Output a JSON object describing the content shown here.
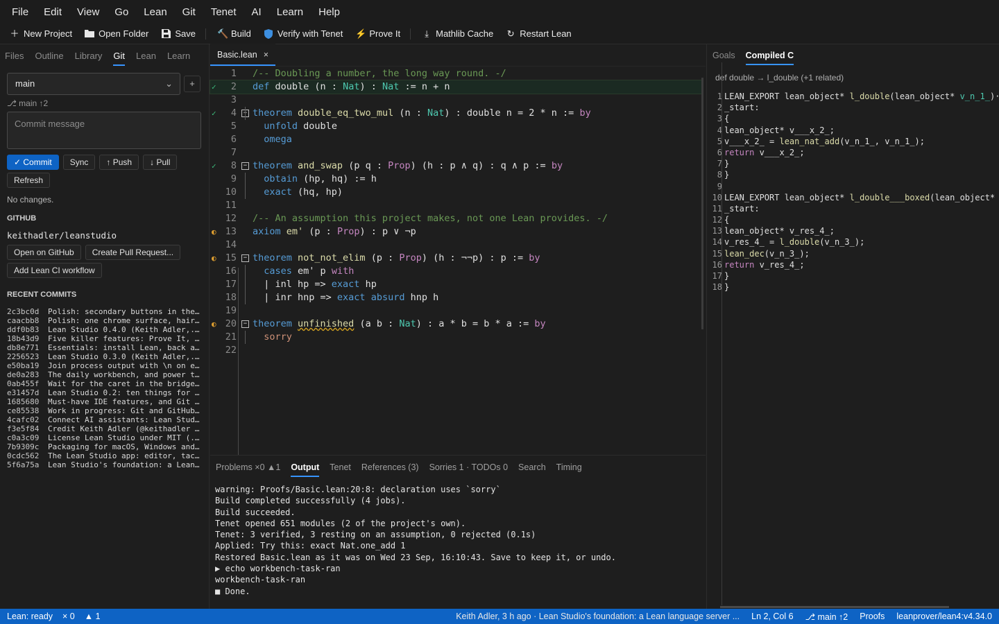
{
  "menu": [
    "File",
    "Edit",
    "View",
    "Go",
    "Lean",
    "Git",
    "Tenet",
    "AI",
    "Learn",
    "Help"
  ],
  "toolbar": {
    "new_project": "New Project",
    "open_folder": "Open Folder",
    "save": "Save",
    "build": "Build",
    "verify": "Verify with Tenet",
    "prove": "Prove It",
    "mathlib": "Mathlib Cache",
    "restart": "Restart Lean"
  },
  "left_tabs": [
    "Files",
    "Outline",
    "Library",
    "Git",
    "Lean",
    "Learn"
  ],
  "git": {
    "branch": "main",
    "plus": "+",
    "branch_info": "⎇ main ↑2",
    "commit_placeholder": "Commit message",
    "commit": "✓ Commit",
    "sync": "Sync",
    "push": "↑ Push",
    "pull": "↓ Pull",
    "refresh": "Refresh",
    "no_changes": "No changes.",
    "github_heading": "GITHUB",
    "repo": "keithadler/leanstudio",
    "open_github": "Open on GitHub",
    "create_pr": "Create Pull Request...",
    "add_ci": "Add Lean CI workflow",
    "recent_heading": "RECENT COMMITS",
    "commits": [
      {
        "hash": "2c3bc0d",
        "msg": "Polish: secondary buttons in the..."
      },
      {
        "hash": "caacbb8",
        "msg": "Polish: one chrome surface, hair..."
      },
      {
        "hash": "ddf0b83",
        "msg": "Lean Studio 0.4.0  (Keith Adler,..."
      },
      {
        "hash": "18b43d9",
        "msg": "Five killer features: Prove It, ..."
      },
      {
        "hash": "db8e771",
        "msg": "Essentials: install Lean, back a..."
      },
      {
        "hash": "2256523",
        "msg": "Lean Studio 0.3.0  (Keith Adler,..."
      },
      {
        "hash": "e50ba19",
        "msg": "Join process output with \\n on e..."
      },
      {
        "hash": "de0a283",
        "msg": "The daily workbench, and power t..."
      },
      {
        "hash": "0ab455f",
        "msg": "Wait for the caret in the bridge..."
      },
      {
        "hash": "e31457d",
        "msg": "Lean Studio 0.2: ten things for ..."
      },
      {
        "hash": "1685680",
        "msg": "Must-have IDE features, and Git ..."
      },
      {
        "hash": "ce85538",
        "msg": "Work in progress: Git and GitHub..."
      },
      {
        "hash": "4cafc02",
        "msg": "Connect AI assistants: Lean Stud..."
      },
      {
        "hash": "f3e5f84",
        "msg": "Credit Keith Adler (@keithadler ..."
      },
      {
        "hash": "c0a3c09",
        "msg": "License Lean Studio under MIT  (..."
      },
      {
        "hash": "7b9309c",
        "msg": "Packaging for macOS, Windows and..."
      },
      {
        "hash": "0cdc562",
        "msg": "The Lean Studio app: editor, tac..."
      },
      {
        "hash": "5f6a75a",
        "msg": "Lean Studio's foundation: a Lean..."
      }
    ]
  },
  "editor": {
    "tab": "Basic.lean",
    "close": "×",
    "lines": [
      {
        "n": "1",
        "seg": [
          [
            "c",
            "/-- Doubling a number, the long way round. -/"
          ]
        ]
      },
      {
        "n": "2",
        "g": "✓",
        "seg": [
          [
            "k",
            "def "
          ],
          [
            "w",
            "double "
          ],
          [
            "w",
            "(n : "
          ],
          [
            "t",
            "Nat"
          ],
          [
            "w",
            ") : "
          ],
          [
            "t",
            "Nat"
          ],
          [
            "w",
            " := n + n"
          ]
        ]
      },
      {
        "n": "3",
        "seg": []
      },
      {
        "n": "4",
        "g": "✓",
        "fold": "−",
        "seg": [
          [
            "k",
            "theorem "
          ],
          [
            "f",
            "double_eq_two_mul "
          ],
          [
            "w",
            "(n : "
          ],
          [
            "t",
            "Nat"
          ],
          [
            "w",
            ") : double n = 2 * n := "
          ],
          [
            "kp",
            "by"
          ]
        ]
      },
      {
        "n": "5",
        "seg": [
          [
            "w",
            "  "
          ],
          [
            "k",
            "unfold"
          ],
          [
            "w",
            " double"
          ]
        ]
      },
      {
        "n": "6",
        "seg": [
          [
            "w",
            "  "
          ],
          [
            "k",
            "omega"
          ]
        ]
      },
      {
        "n": "7",
        "seg": []
      },
      {
        "n": "8",
        "g": "✓",
        "fold": "−",
        "seg": [
          [
            "k",
            "theorem "
          ],
          [
            "f",
            "and_swap "
          ],
          [
            "w",
            "(p q : "
          ],
          [
            "kp",
            "Prop"
          ],
          [
            "w",
            ") (h : p ∧ q) : q ∧ p := "
          ],
          [
            "kp",
            "by"
          ]
        ]
      },
      {
        "n": "9",
        "seg": [
          [
            "w",
            "  "
          ],
          [
            "k",
            "obtain"
          ],
          [
            "w",
            " (hp, hq) := h"
          ]
        ]
      },
      {
        "n": "10",
        "seg": [
          [
            "w",
            "  "
          ],
          [
            "k",
            "exact"
          ],
          [
            "w",
            " (hq, hp)"
          ]
        ]
      },
      {
        "n": "11",
        "seg": []
      },
      {
        "n": "12",
        "seg": [
          [
            "c",
            "/-- An assumption this project makes, not one Lean provides. -/"
          ]
        ]
      },
      {
        "n": "13",
        "g": "◐",
        "seg": [
          [
            "k",
            "axiom "
          ],
          [
            "f",
            "em' "
          ],
          [
            "w",
            "(p : "
          ],
          [
            "kp",
            "Prop"
          ],
          [
            "w",
            ") : p ∨ ¬p"
          ]
        ]
      },
      {
        "n": "14",
        "seg": []
      },
      {
        "n": "15",
        "g": "◐",
        "fold": "−",
        "seg": [
          [
            "k",
            "theorem "
          ],
          [
            "f",
            "not_not_elim "
          ],
          [
            "w",
            "(p : "
          ],
          [
            "kp",
            "Prop"
          ],
          [
            "w",
            ") (h : ¬¬p) : p := "
          ],
          [
            "kp",
            "by"
          ]
        ]
      },
      {
        "n": "16",
        "seg": [
          [
            "w",
            "  "
          ],
          [
            "k",
            "cases"
          ],
          [
            "w",
            " em' p "
          ],
          [
            "kp",
            "with"
          ]
        ]
      },
      {
        "n": "17",
        "seg": [
          [
            "w",
            "  | inl hp => "
          ],
          [
            "k",
            "exact"
          ],
          [
            "w",
            " hp"
          ]
        ]
      },
      {
        "n": "18",
        "seg": [
          [
            "w",
            "  | inr hnp => "
          ],
          [
            "k",
            "exact"
          ],
          [
            "w",
            " "
          ],
          [
            "k",
            "absurd"
          ],
          [
            "w",
            " hnp h"
          ]
        ]
      },
      {
        "n": "19",
        "seg": []
      },
      {
        "n": "20",
        "g": "◐",
        "fold": "−",
        "seg": [
          [
            "k",
            "theorem "
          ],
          [
            "y",
            "unfinished"
          ],
          [
            "w",
            " (a b : "
          ],
          [
            "t",
            "Nat"
          ],
          [
            "w",
            ") : a * b = b * a := "
          ],
          [
            "kp",
            "by"
          ]
        ]
      },
      {
        "n": "21",
        "seg": [
          [
            "w",
            "  "
          ],
          [
            "sr",
            "sorry"
          ]
        ]
      },
      {
        "n": "22",
        "seg": []
      }
    ]
  },
  "panel": {
    "tabs": [
      "Problems ×0 ▲1",
      "Output",
      "Tenet",
      "References (3)",
      "Sorries 1 · TODOs 0",
      "Search",
      "Timing"
    ],
    "output": [
      "warning: Proofs/Basic.lean:20:8: declaration uses `sorry`",
      "Build completed successfully (4 jobs).",
      "Build succeeded.",
      "Tenet opened 651 modules (2 of the project's own).",
      "Tenet: 3 verified, 3 resting on an assumption, 0 rejected (0.1s)",
      "Applied: Try this: exact Nat.one_add 1",
      "Restored Basic.lean as it was on Wed 23 Sep, 16:10:43. Save to keep it, or undo.",
      "▶ echo workbench-task-ran",
      "workbench-task-ran",
      "■ Done."
    ]
  },
  "right": {
    "tabs": [
      "Goals",
      "Compiled C"
    ],
    "related": "def double → l_double (+1 related)",
    "lines": [
      {
        "n": "1",
        "seg": [
          [
            "w",
            "LEAN_EXPORT lean_object* "
          ],
          [
            "f",
            "l_double"
          ],
          [
            "w",
            "(lean_object* "
          ],
          [
            "t",
            "v_n_1_"
          ],
          [
            "w",
            ")·"
          ]
        ]
      },
      {
        "n": "2",
        "seg": [
          [
            "w",
            "_start:"
          ]
        ]
      },
      {
        "n": "3",
        "seg": [
          [
            "w",
            "{"
          ]
        ]
      },
      {
        "n": "4",
        "seg": [
          [
            "w",
            "lean_object* v___x_2_;"
          ]
        ]
      },
      {
        "n": "5",
        "seg": [
          [
            "w",
            "v___x_2_ = "
          ],
          [
            "f",
            "lean_nat_add"
          ],
          [
            "w",
            "(v_n_1_, v_n_1_);"
          ]
        ]
      },
      {
        "n": "6",
        "seg": [
          [
            "kp",
            "return"
          ],
          [
            "w",
            " v___x_2_;"
          ]
        ]
      },
      {
        "n": "7",
        "seg": [
          [
            "w",
            "}"
          ]
        ]
      },
      {
        "n": "8",
        "seg": [
          [
            "w",
            "}"
          ]
        ]
      },
      {
        "n": "9",
        "seg": []
      },
      {
        "n": "10",
        "seg": [
          [
            "w",
            "LEAN_EXPORT lean_object* "
          ],
          [
            "f",
            "l_double___boxed"
          ],
          [
            "w",
            "(lean_object*"
          ]
        ]
      },
      {
        "n": "11",
        "seg": [
          [
            "w",
            "_start:"
          ]
        ]
      },
      {
        "n": "12",
        "seg": [
          [
            "w",
            "{"
          ]
        ]
      },
      {
        "n": "13",
        "seg": [
          [
            "w",
            "lean_object* v_res_4_;"
          ]
        ]
      },
      {
        "n": "14",
        "seg": [
          [
            "w",
            "v_res_4_ = "
          ],
          [
            "f",
            "l_double"
          ],
          [
            "w",
            "(v_n_3_);"
          ]
        ]
      },
      {
        "n": "15",
        "seg": [
          [
            "f",
            "lean_dec"
          ],
          [
            "w",
            "(v_n_3_);"
          ]
        ]
      },
      {
        "n": "16",
        "seg": [
          [
            "kp",
            "return"
          ],
          [
            "w",
            " v_res_4_;"
          ]
        ]
      },
      {
        "n": "17",
        "seg": [
          [
            "w",
            "}"
          ]
        ]
      },
      {
        "n": "18",
        "seg": [
          [
            "w",
            "}"
          ]
        ]
      }
    ]
  },
  "status": {
    "lean": "Lean: ready",
    "errors": "× 0",
    "warnings": "▲ 1",
    "blame": "Keith Adler, 3 h ago · Lean Studio's foundation: a Lean language server ...",
    "position": "Ln 2, Col 6",
    "branch": "⎇ main ↑2",
    "project": "Proofs",
    "toolchain": "leanprover/lean4:v4.34.0"
  }
}
